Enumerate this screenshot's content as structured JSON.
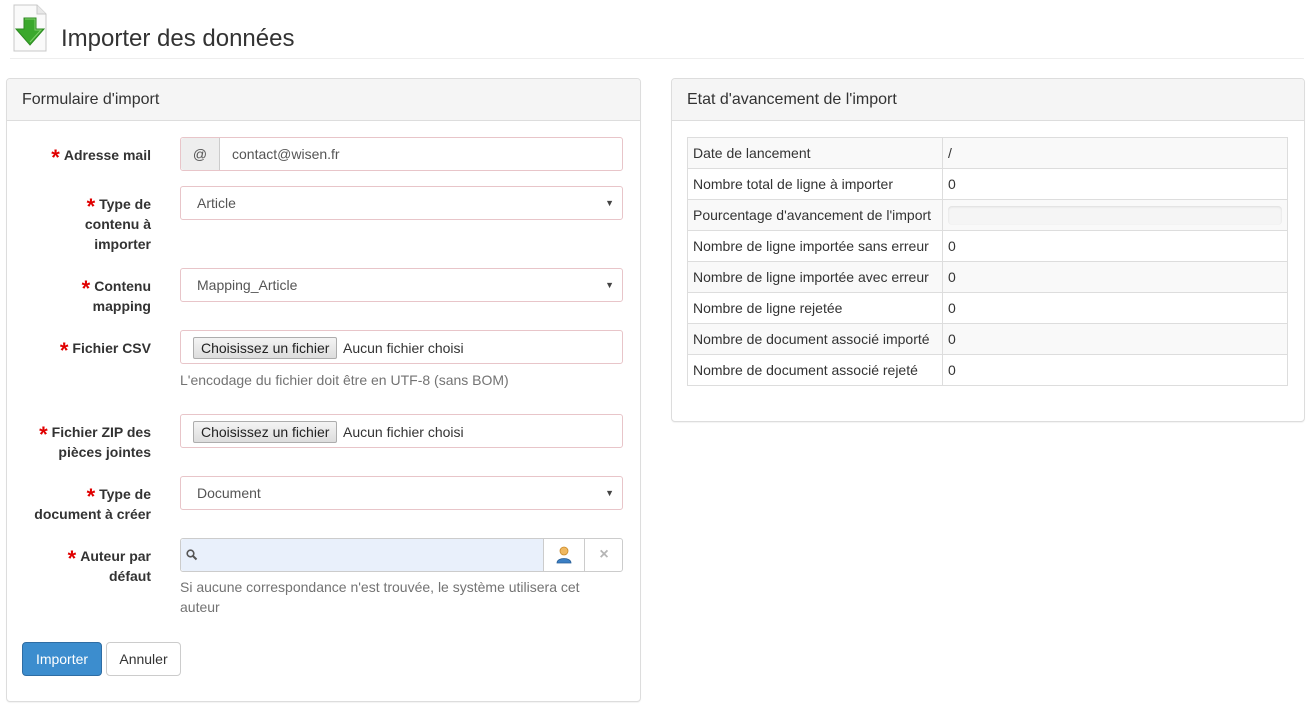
{
  "page": {
    "title": "Importer des données"
  },
  "form": {
    "heading": "Formulaire d'import",
    "required_mark": "*",
    "email": {
      "label": "Adresse mail",
      "addon": "@",
      "value": "contact@wisen.fr"
    },
    "content_type": {
      "label_line1": "Type de",
      "label_line2": "contenu à",
      "label_line3": "importer",
      "value": "Article"
    },
    "mapping": {
      "label_line1": "Contenu",
      "label_line2": "mapping",
      "value": "Mapping_Article"
    },
    "csv": {
      "label": "Fichier CSV",
      "button": "Choisissez un fichier",
      "none": "Aucun fichier choisi",
      "help": "L'encodage du fichier doit être en UTF-8 (sans BOM)"
    },
    "zip": {
      "label_line1": "Fichier ZIP des",
      "label_line2": "pièces jointes",
      "button": "Choisissez un fichier",
      "none": "Aucun fichier choisi"
    },
    "doc_type": {
      "label_line1": "Type de",
      "label_line2": "document à créer",
      "value": "Document"
    },
    "author": {
      "label_line1": "Auteur par",
      "label_line2": "défaut",
      "value": "",
      "clear_icon": "×",
      "help_line1": "Si aucune correspondance n'est trouvée, le système utilisera cet",
      "help_line2": "auteur"
    },
    "buttons": {
      "import": "Importer",
      "cancel": "Annuler"
    }
  },
  "status": {
    "heading": "Etat d'avancement de l'import",
    "rows": [
      {
        "label": "Date de lancement",
        "value": "/"
      },
      {
        "label": "Nombre total de ligne à importer",
        "value": "0"
      },
      {
        "label": "Pourcentage d'avancement de l'import",
        "progress": 0
      },
      {
        "label": "Nombre de ligne importée sans erreur",
        "value": "0"
      },
      {
        "label": "Nombre de ligne importée avec erreur",
        "value": "0"
      },
      {
        "label": "Nombre de ligne rejetée",
        "value": "0"
      },
      {
        "label": "Nombre de document associé importé",
        "value": "0"
      },
      {
        "label": "Nombre de document associé rejeté",
        "value": "0"
      }
    ]
  },
  "colors": {
    "primary": "#3c8dce",
    "required": "#e00000",
    "icon_green": "#3aa82c"
  },
  "icons": {
    "page": "download-arrow-document-icon",
    "search": "search-icon",
    "user": "user-icon",
    "clear": "close-icon",
    "select": "caret-down-icon"
  }
}
